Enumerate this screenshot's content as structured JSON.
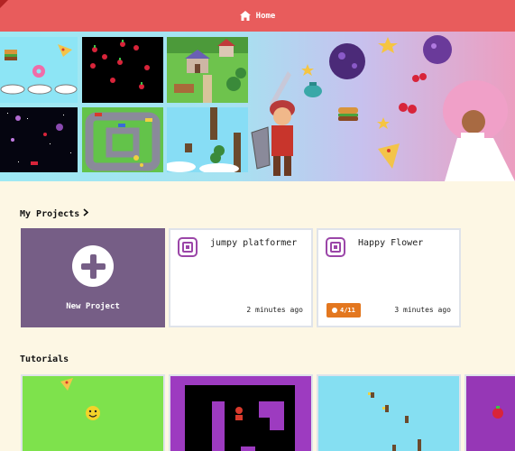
{
  "header": {
    "home_label": "Home",
    "accent": "#e85c5c"
  },
  "sections": {
    "projects_title": "My Projects",
    "tutorials_title": "Tutorials"
  },
  "new_project": {
    "label": "New Project",
    "color": "#765e86"
  },
  "projects": [
    {
      "name": "jumpy platformer",
      "time": "2 minutes ago",
      "badge": ""
    },
    {
      "name": "Happy Flower",
      "time": "3 minutes ago",
      "badge": "4/11"
    }
  ],
  "icons": [
    "home-icon",
    "chevron-right-icon",
    "plus-icon",
    "project-icon"
  ],
  "colors": {
    "background": "#fdf7e4",
    "card_border": "#dfe3ea",
    "badge": "#e3771f",
    "project_icon": "#9b46a8"
  }
}
